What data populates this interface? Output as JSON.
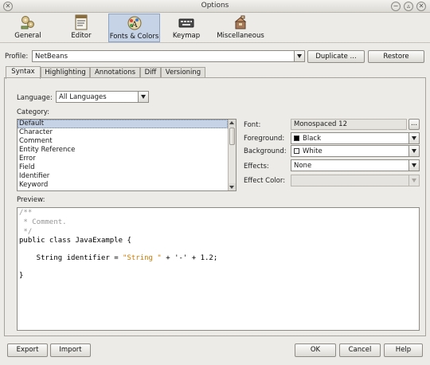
{
  "window": {
    "title": "Options"
  },
  "toolbar": {
    "items": [
      {
        "label": "General",
        "icon": "general-icon"
      },
      {
        "label": "Editor",
        "icon": "editor-icon"
      },
      {
        "label": "Fonts & Colors",
        "icon": "fonts-colors-icon",
        "selected": true
      },
      {
        "label": "Keymap",
        "icon": "keymap-icon"
      },
      {
        "label": "Miscellaneous",
        "icon": "miscellaneous-icon"
      }
    ]
  },
  "profile": {
    "label": "Profile:",
    "value": "NetBeans",
    "duplicate_label": "Duplicate ...",
    "restore_label": "Restore"
  },
  "tabs": [
    "Syntax",
    "Highlighting",
    "Annotations",
    "Diff",
    "Versioning"
  ],
  "syntax": {
    "language_label": "Language:",
    "language_value": "All Languages",
    "category_label": "Category:",
    "categories": [
      "Default",
      "Character",
      "Comment",
      "Entity Reference",
      "Error",
      "Field",
      "Identifier",
      "Keyword"
    ],
    "selected_category": "Default"
  },
  "properties": {
    "font_label": "Font:",
    "font_value": "Monospaced 12",
    "font_button": "...",
    "foreground_label": "Foreground:",
    "foreground_value": "Black",
    "foreground_color": "#000000",
    "background_label": "Background:",
    "background_value": "White",
    "background_color": "#ffffff",
    "effects_label": "Effects:",
    "effects_value": "None",
    "effect_color_label": "Effect Color:"
  },
  "preview": {
    "label": "Preview:",
    "lines": [
      "/**",
      " * Comment.",
      " */",
      "public class JavaExample {",
      "",
      "    String identifier = \"String \" + '-' + 1.2;",
      "",
      "}"
    ]
  },
  "footer": {
    "export_label": "Export",
    "import_label": "Import",
    "ok_label": "OK",
    "cancel_label": "Cancel",
    "help_label": "Help"
  },
  "colors": {
    "selection": "#c6d3e6",
    "comment_text": "#969696",
    "string_text": "#ce7b00"
  }
}
